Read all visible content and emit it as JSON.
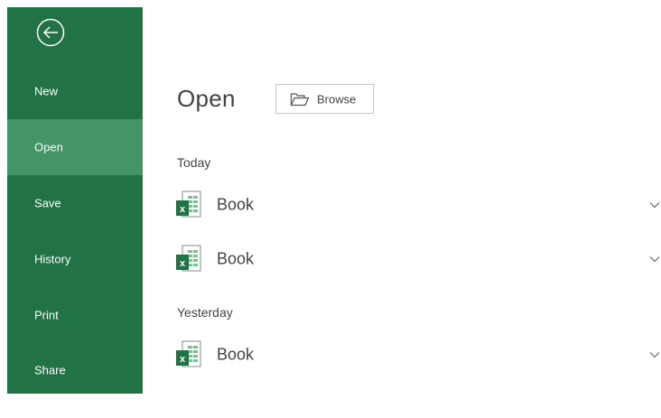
{
  "sidebar": {
    "back_icon": "back-arrow-circle-icon",
    "items": [
      {
        "label": "New"
      },
      {
        "label": "Open"
      },
      {
        "label": "Save"
      },
      {
        "label": "History"
      },
      {
        "label": "Print"
      },
      {
        "label": "Share"
      }
    ],
    "active_item": "Open"
  },
  "main": {
    "title": "Open",
    "browse": {
      "label": "Browse",
      "icon": "folder-open-icon"
    },
    "groups": [
      {
        "header": "Today",
        "files": [
          {
            "name": "Book",
            "icon": "excel-file-icon"
          },
          {
            "name": "Book",
            "icon": "excel-file-icon"
          }
        ]
      },
      {
        "header": "Yesterday",
        "files": [
          {
            "name": "Book",
            "icon": "excel-file-icon"
          }
        ]
      }
    ]
  },
  "colors": {
    "sidebar_bg": "#217346",
    "sidebar_active": "#439467",
    "excel_green": "#217346",
    "text": "#444444"
  }
}
